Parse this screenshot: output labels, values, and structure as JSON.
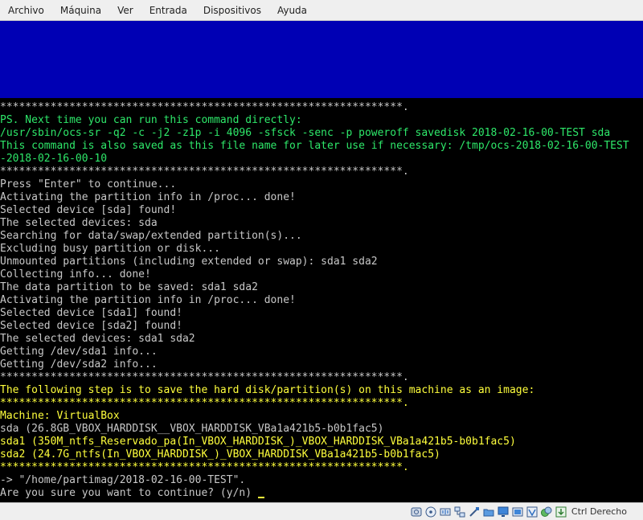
{
  "menubar": {
    "items": [
      "Archivo",
      "Máquina",
      "Ver",
      "Entrada",
      "Dispositivos",
      "Ayuda"
    ]
  },
  "terminal": {
    "lines": [
      {
        "text": "****************************************************************.",
        "color": "white"
      },
      {
        "text": "PS. Next time you can run this command directly:",
        "color": "green"
      },
      {
        "text": "/usr/sbin/ocs-sr -q2 -c -j2 -z1p -i 4096 -sfsck -senc -p poweroff savedisk 2018-02-16-00-TEST sda",
        "color": "green"
      },
      {
        "text": "This command is also saved as this file name for later use if necessary: /tmp/ocs-2018-02-16-00-TEST",
        "color": "green"
      },
      {
        "text": "-2018-02-16-00-10",
        "color": "green"
      },
      {
        "text": "****************************************************************.",
        "color": "white"
      },
      {
        "text": "Press \"Enter\" to continue...",
        "color": "white"
      },
      {
        "text": "Activating the partition info in /proc... done!",
        "color": "white"
      },
      {
        "text": "Selected device [sda] found!",
        "color": "white"
      },
      {
        "text": "The selected devices: sda",
        "color": "white"
      },
      {
        "text": "Searching for data/swap/extended partition(s)...",
        "color": "white"
      },
      {
        "text": "Excluding busy partition or disk...",
        "color": "white"
      },
      {
        "text": "Unmounted partitions (including extended or swap): sda1 sda2",
        "color": "white"
      },
      {
        "text": "Collecting info... done!",
        "color": "white"
      },
      {
        "text": "The data partition to be saved: sda1 sda2",
        "color": "white"
      },
      {
        "text": "Activating the partition info in /proc... done!",
        "color": "white"
      },
      {
        "text": "Selected device [sda1] found!",
        "color": "white"
      },
      {
        "text": "Selected device [sda2] found!",
        "color": "white"
      },
      {
        "text": "The selected devices: sda1 sda2",
        "color": "white"
      },
      {
        "text": "Getting /dev/sda1 info...",
        "color": "white"
      },
      {
        "text": "Getting /dev/sda2 info...",
        "color": "white"
      },
      {
        "text": "****************************************************************.",
        "color": "white"
      },
      {
        "text": "The following step is to save the hard disk/partition(s) on this machine as an image:",
        "color": "yellow"
      },
      {
        "text": "****************************************************************.",
        "color": "yellow"
      },
      {
        "text": "Machine: VirtualBox",
        "color": "yellow"
      },
      {
        "text": "sda (26.8GB_VBOX_HARDDISK__VBOX_HARDDISK_VBa1a421b5-b0b1fac5)",
        "color": "white"
      },
      {
        "text": "sda1 (350M_ntfs_Reservado_pa(In_VBOX_HARDDISK_)_VBOX_HARDDISK_VBa1a421b5-b0b1fac5)",
        "color": "yellow"
      },
      {
        "text": "sda2 (24.7G_ntfs(In_VBOX_HARDDISK_)_VBOX_HARDDISK_VBa1a421b5-b0b1fac5)",
        "color": "yellow"
      },
      {
        "text": "****************************************************************.",
        "color": "yellow"
      },
      {
        "text": "-> \"/home/partimag/2018-02-16-00-TEST\".",
        "color": "white"
      },
      {
        "text": "Are you sure you want to continue? (y/n) ",
        "color": "white"
      }
    ]
  },
  "statusbar": {
    "icons": [
      "hard-disk-icon",
      "optical-drive-icon",
      "audio-icon",
      "network-icon",
      "usb-icon",
      "shared-folders-icon",
      "display-icon",
      "video-capture-icon",
      "virtualization-icon",
      "mouse-integration-icon",
      "keyboard-capture-icon"
    ],
    "host_key_label": "Ctrl Derecho"
  },
  "colors": {
    "terminal_bg": "#000000",
    "banner_blue": "#0000b4",
    "white_text": "#c8c8c8",
    "green_text": "#2ee86a",
    "yellow_text": "#ffff3c"
  }
}
